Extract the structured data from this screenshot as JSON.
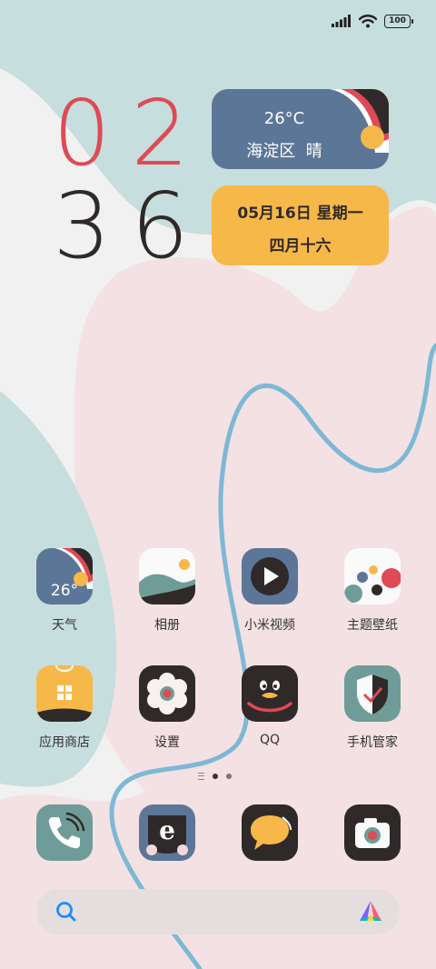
{
  "status_bar": {
    "battery": "100"
  },
  "clock": {
    "hour_d1": "0",
    "hour_d2": "2",
    "min_d1": "3",
    "min_d2": "6"
  },
  "weather_widget": {
    "temperature": "26°C",
    "location": "海淀区",
    "condition": "晴"
  },
  "date_widget": {
    "date": "05月16日",
    "weekday": "星期一",
    "lunar": "四月十六"
  },
  "apps": [
    {
      "label": "天气",
      "icon": "weather-icon",
      "text": "26°"
    },
    {
      "label": "相册",
      "icon": "gallery-icon"
    },
    {
      "label": "小米视频",
      "icon": "video-icon"
    },
    {
      "label": "主题壁纸",
      "icon": "themes-icon"
    },
    {
      "label": "应用商店",
      "icon": "app-store-icon"
    },
    {
      "label": "设置",
      "icon": "settings-icon"
    },
    {
      "label": "QQ",
      "icon": "qq-icon"
    },
    {
      "label": "手机管家",
      "icon": "security-icon"
    }
  ],
  "dock": [
    {
      "icon": "phone-icon"
    },
    {
      "icon": "browser-icon",
      "text": "e"
    },
    {
      "icon": "messages-icon"
    },
    {
      "icon": "camera-icon"
    }
  ],
  "colors": {
    "red": "#de4a55",
    "dark": "#2f2a29",
    "slate": "#5c7697",
    "yellow": "#f7b84a",
    "teal": "#6f9c98",
    "mint": "#c3dcdb",
    "pink": "#f3e1e3"
  }
}
